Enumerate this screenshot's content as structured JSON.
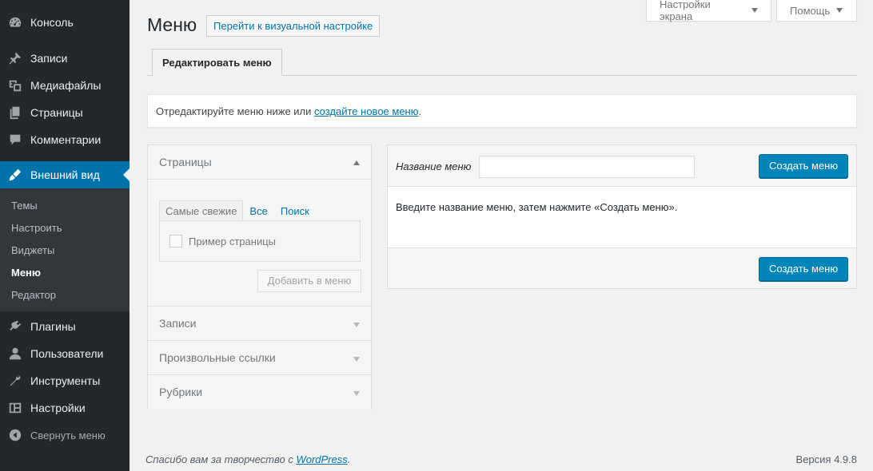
{
  "sidebar": {
    "items": [
      {
        "label": "Консоль",
        "icon": "dashboard-icon"
      },
      {
        "label": "Записи",
        "icon": "pin-icon"
      },
      {
        "label": "Медиафайлы",
        "icon": "media-icon"
      },
      {
        "label": "Страницы",
        "icon": "pages-icon"
      },
      {
        "label": "Комментарии",
        "icon": "comment-icon"
      },
      {
        "label": "Внешний вид",
        "icon": "appearance-icon"
      },
      {
        "label": "Плагины",
        "icon": "plugin-icon"
      },
      {
        "label": "Пользователи",
        "icon": "users-icon"
      },
      {
        "label": "Инструменты",
        "icon": "tools-icon"
      },
      {
        "label": "Настройки",
        "icon": "settings-icon"
      }
    ],
    "submenu": [
      "Темы",
      "Настроить",
      "Виджеты",
      "Меню",
      "Редактор"
    ],
    "collapse_label": "Свернуть меню"
  },
  "screen_meta": {
    "screen_options": "Настройки экрана",
    "help": "Помощь"
  },
  "header": {
    "title": "Меню",
    "visual_button": "Перейти к визуальной настройке",
    "tab_edit": "Редактировать меню"
  },
  "notice": {
    "text_before": "Отредактируйте меню ниже или ",
    "link": "создайте новое меню",
    "text_after": "."
  },
  "accordion": {
    "sections": [
      "Страницы",
      "Записи",
      "Произвольные ссылки",
      "Рубрики"
    ],
    "pages_tabs": [
      "Самые свежие",
      "Все",
      "Поиск"
    ],
    "sample_page": "Пример страницы",
    "add_button": "Добавить в меню"
  },
  "manage": {
    "name_label": "Название меню",
    "name_value": "",
    "create_button": "Создать меню",
    "instruction": "Введите название меню, затем нажмите «Создать меню»."
  },
  "footer": {
    "thanks_before": "Спасибо вам за творчество с ",
    "thanks_link": "WordPress",
    "thanks_after": ".",
    "version": "Версия 4.9.8"
  },
  "colors": {
    "sidebar_bg": "#23282d",
    "submenu_bg": "#32373c",
    "accent": "#0073aa",
    "primary_button": "#0085ba",
    "page_bg": "#f1f1f1"
  }
}
